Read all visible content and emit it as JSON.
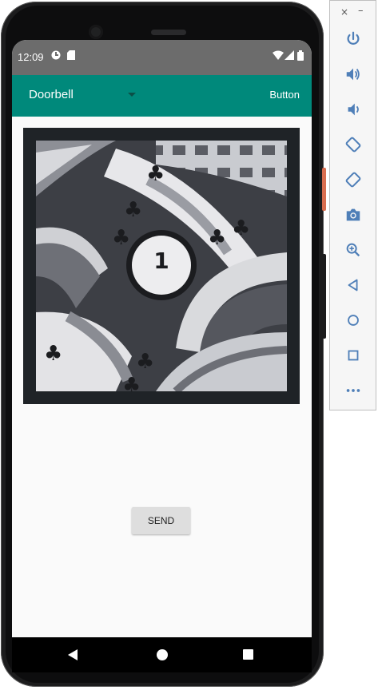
{
  "status_bar": {
    "time": "12:09"
  },
  "toolbar": {
    "spinner_value": "Doorbell",
    "button_label": "Button"
  },
  "image": {
    "badge_number": "1"
  },
  "send_button": {
    "label": "SEND"
  },
  "emulator_toolbar": {
    "close_glyph": "×",
    "minimize_glyph": "–",
    "items": [
      "power-icon",
      "volume-up-icon",
      "volume-down-icon",
      "rotate-left-icon",
      "rotate-right-icon",
      "camera-icon",
      "zoom-icon",
      "back-icon",
      "home-icon",
      "overview-icon",
      "more-icon"
    ]
  },
  "colors": {
    "accent": "#00897b",
    "status_bar": "#6c6c6c",
    "screen_bg": "#fafafa"
  }
}
